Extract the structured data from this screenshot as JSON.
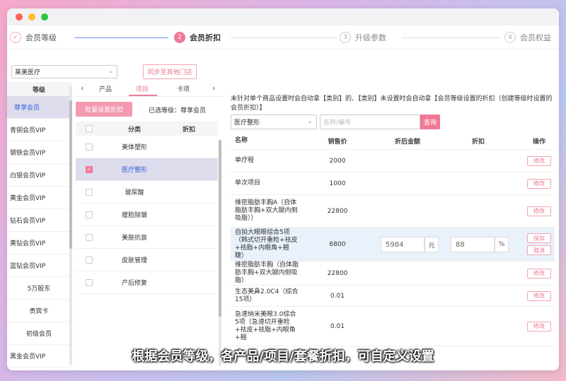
{
  "steps": [
    {
      "label": "会员等级",
      "num": "✓",
      "state": "done"
    },
    {
      "label": "会员折扣",
      "num": "2",
      "state": "active"
    },
    {
      "label": "升级参数",
      "num": "3",
      "state": "todo"
    },
    {
      "label": "会员权益",
      "num": "4",
      "state": "todo"
    }
  ],
  "store_select": {
    "value": "莱美医疗",
    "icon": "chevron-down-icon"
  },
  "sync_button": "同步至其他门店",
  "levels": {
    "header": "等级",
    "items": [
      "尊享会员",
      "青铜会员VIP",
      "钢铁会员VIP",
      "白银会员VIP",
      "黄金会员VIP",
      "钻石会员VIP",
      "黄钻会员VIP",
      "蓝钻会员VIP",
      "5万股东",
      "贵宾卡",
      "初级会员",
      "黑金会员VIP"
    ],
    "active_index": 0
  },
  "tabs": {
    "items": [
      "产品",
      "项目",
      "卡项"
    ],
    "active_index": 1,
    "prev": "‹",
    "next": "›"
  },
  "batch_button": "批量设置折扣",
  "selected_level": "已选等级：尊享会员",
  "categories": {
    "headers": {
      "name": "分类",
      "discount": "折扣"
    },
    "rows": [
      {
        "name": "美体塑形",
        "checked": false
      },
      {
        "name": "医疗整形",
        "checked": true
      },
      {
        "name": "玻尿酸",
        "checked": false
      },
      {
        "name": "瘦脸除皱",
        "checked": false
      },
      {
        "name": "美肤抗衰",
        "checked": false
      },
      {
        "name": "皮肤管理",
        "checked": false
      },
      {
        "name": "产后修复",
        "checked": false
      }
    ]
  },
  "notice": "未针对单个商品设置时会自动拿【类别】的、【类别】未设置时会自动拿【会员等级设置的折扣（创建等级时设置的会员折扣）】",
  "filter": {
    "category": "医疗整形",
    "search_placeholder": "名称/编号",
    "query_button": "查询"
  },
  "products": {
    "headers": {
      "name": "名称",
      "price": "销售价",
      "after": "折后金额",
      "discount": "折扣",
      "op": "操作"
    },
    "rows": [
      {
        "name": "单疗程",
        "price": "2000",
        "edit": "修改"
      },
      {
        "name": "单次项目",
        "price": "1000",
        "edit": "修改"
      },
      {
        "name": "维密脂肪丰胸A（自体脂肪丰胸+双大腿内侧吸脂））",
        "price": "22800",
        "edit": "修改"
      },
      {
        "name": "自拍大眼眼综合5项（韩式切开重睑+祛皮+祛脂+内眼角+翘睫）",
        "price": "6800",
        "after_value": "5984",
        "after_unit": "元",
        "discount_value": "88",
        "discount_unit": "%",
        "save": "保存",
        "cancel": "取消"
      },
      {
        "name": "维密脂肪丰胸（自体脂肪丰胸+双大腿内侧吸脂）",
        "price": "22800",
        "edit": "修改"
      },
      {
        "name": "生态美鼻2.0C4（综合15项）",
        "price": "0.01",
        "edit": "修改"
      },
      {
        "name": "急速纳米美眼3.0综合5项（急速切开重睑+祛皮+祛脂+内眼角+翘",
        "price": "0.01",
        "edit": "修改"
      }
    ]
  },
  "caption": "根据会员等级，各产品/项目/套餐折扣，可自定义设置",
  "colors": {
    "accent": "#f07996",
    "active_text": "#3a62d8",
    "progress_line": "#6c8ff0"
  }
}
